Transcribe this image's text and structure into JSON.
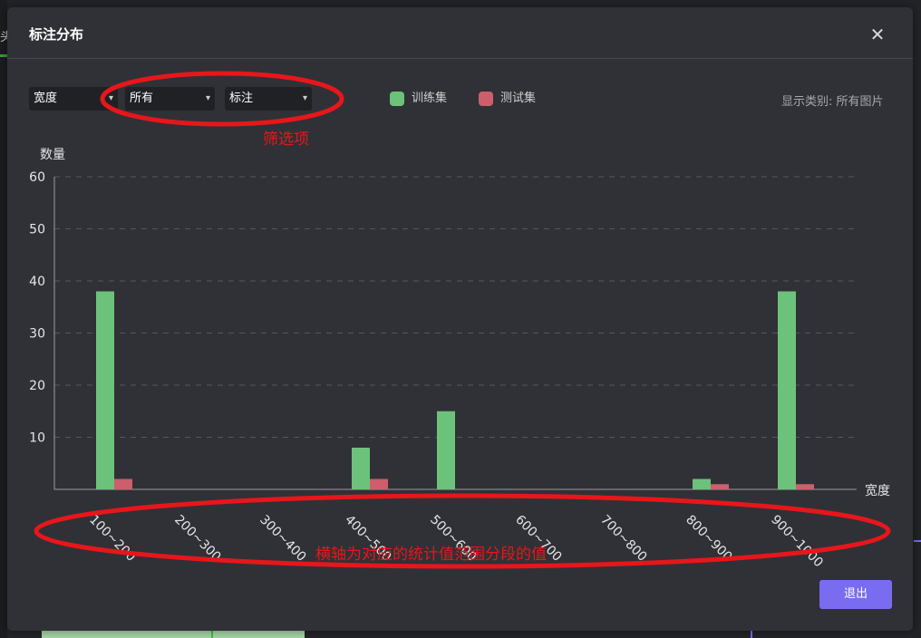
{
  "background": {
    "left_text": "头"
  },
  "modal": {
    "title": "标注分布",
    "close_glyph": "✕",
    "filters": [
      {
        "value": "宽度"
      },
      {
        "value": "所有"
      },
      {
        "value": "标注"
      }
    ],
    "show_category_label": "显示类别:",
    "show_category_value": "所有图片",
    "exit_label": "退出"
  },
  "annotations": {
    "filter_note": "筛选项",
    "axis_note": "横轴为对应的统计值范围分段的值",
    "color": "#e8161b"
  },
  "colors": {
    "train": "#6cc27a",
    "test": "#cc5f6b",
    "accent": "#7a6cf0"
  },
  "chart_data": {
    "type": "bar",
    "ylabel": "数量",
    "xlabel": "宽度",
    "ylim": [
      0,
      60
    ],
    "yticks": [
      10,
      20,
      30,
      40,
      50,
      60
    ],
    "grid": true,
    "legend_position": "top",
    "categories": [
      "100~200",
      "200~300",
      "300~400",
      "400~500",
      "500~600",
      "600~700",
      "700~800",
      "800~900",
      "900~1000"
    ],
    "series": [
      {
        "name": "训练集",
        "color": "#6cc27a",
        "values": [
          38,
          0,
          0,
          8,
          15,
          0,
          0,
          2,
          38
        ]
      },
      {
        "name": "测试集",
        "color": "#cc5f6b",
        "values": [
          2,
          0,
          0,
          2,
          0,
          0,
          0,
          1,
          1
        ]
      }
    ]
  }
}
